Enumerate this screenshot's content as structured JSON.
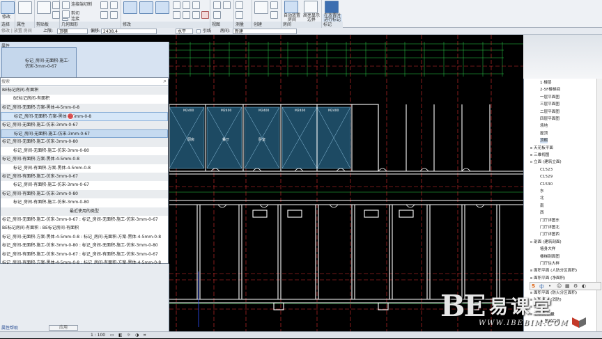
{
  "ribbon": {
    "modify_label": "修改",
    "groups": [
      {
        "label": "选择"
      },
      {
        "label": "属性"
      },
      {
        "label": "剪贴板"
      },
      {
        "label": "几何图形"
      },
      {
        "label": "修改"
      },
      {
        "label": "视图"
      },
      {
        "label": "测量"
      },
      {
        "label": "创建"
      },
      {
        "label": "房间"
      },
      {
        "label": "标记"
      }
    ],
    "geometry_texts": [
      "连接端切割",
      "剪切",
      "连接"
    ],
    "room_buttons": [
      {
        "label": "自动放置房间"
      },
      {
        "label": "高亮显示边界"
      }
    ],
    "tag_button": {
      "label": "在放置时进行标记"
    }
  },
  "optbar": {
    "context": "修改 | 放置 房间",
    "upper_label": "上限:",
    "upper_value": "顶棚",
    "offset_label": "偏移:",
    "offset_value": "2438.4",
    "orient_value": "水平",
    "leader_label": "引线",
    "room_label": "房间:",
    "room_value": "新建"
  },
  "properties": {
    "title": "属性",
    "type_name": "标记_房间-无面积-施工-\n仿宋-3mm-0-67",
    "search_placeholder": "搜索",
    "help_link": "属性帮助",
    "apply_label": "应用"
  },
  "dropdown": {
    "rows": [
      {
        "text": "BE标记房间-有面积",
        "kind": "header"
      },
      {
        "text": "BE标记房间-有面积",
        "kind": "item"
      },
      {
        "text": "标记_房间-无面积-方案-黑体-4-5mm-0-8",
        "kind": "header"
      },
      {
        "text": "标记_房间-无面积-方案-黑体-4-5mm-0-8",
        "kind": "hover"
      },
      {
        "text": "标记_房间-无面积-施工-仿宋-3mm-0-67",
        "kind": "header"
      },
      {
        "text": "标记_房间-无面积-施工-仿宋-3mm-0-67",
        "kind": "sel"
      },
      {
        "text": "标记_房间-无面积-施工-仿宋-3mm-0-80",
        "kind": "header"
      },
      {
        "text": "标记_房间-无面积-施工-仿宋-3mm-0-80",
        "kind": "item"
      },
      {
        "text": "标记_房间-有面积-方案-黑体-4-5mm-0-8",
        "kind": "header"
      },
      {
        "text": "标记_房间-有面积-方案-黑体-4-5mm-0-8",
        "kind": "item"
      },
      {
        "text": "标记_房间-有面积-施工-仿宋-3mm-0-67",
        "kind": "header"
      },
      {
        "text": "标记_房间-有面积-施工-仿宋-3mm-0-67",
        "kind": "item"
      },
      {
        "text": "标记_房间-有面积-施工-仿宋-3mm-0-80",
        "kind": "header"
      },
      {
        "text": "标记_房间-有面积-施工-仿宋-3mm-0-80",
        "kind": "item"
      },
      {
        "text": "最近使用的类型",
        "kind": "center"
      },
      {
        "text": "标记_房间-无面积-施工-仿宋-3mm-0-67 : 标记_房间-无面积-施工-仿宋-3mm-0-67",
        "kind": "plain"
      },
      {
        "text": "BE标记房间-有面积 : BE标记房间-有面积",
        "kind": "plain"
      },
      {
        "text": "标记_房间-无面积-方案-黑体-4-5mm-0-8 : 标记_房间-无面积-方案-黑体-4-5mm-0-8",
        "kind": "plain"
      },
      {
        "text": "标记_房间-无面积-施工-仿宋-3mm-0-80 : 标记_房间-无面积-施工-仿宋-3mm-0-80",
        "kind": "plain"
      },
      {
        "text": "标记_房间-有面积-施工-仿宋-3mm-0-67 : 标记_房间-有面积-施工-仿宋-3mm-0-67",
        "kind": "plain"
      },
      {
        "text": "标记_房间-有面积-方案-黑体-4-5mm-0-8 : 标记_房间-有面积-方案-黑体-4-5mm-0-8",
        "kind": "plain"
      }
    ]
  },
  "browser": {
    "items": [
      {
        "text": "1 楼层",
        "indent": 3
      },
      {
        "text": "2-5F楼梯间",
        "indent": 3
      },
      {
        "text": "一层平面图",
        "indent": 3
      },
      {
        "text": "三层平面图",
        "indent": 3
      },
      {
        "text": "二层平面图",
        "indent": 3
      },
      {
        "text": "四层平面图",
        "indent": 3
      },
      {
        "text": "场地",
        "indent": 3
      },
      {
        "text": "屋顶",
        "indent": 3
      },
      {
        "text": "顶棚",
        "indent": 3,
        "selected": true
      },
      {
        "text": "天花板平面",
        "indent": 1,
        "twist": "+"
      },
      {
        "text": "三维视图",
        "indent": 1,
        "twist": "+"
      },
      {
        "text": "立面 (建筑立面)",
        "indent": 1,
        "twist": "-"
      },
      {
        "text": "C1523",
        "indent": 3
      },
      {
        "text": "C1529",
        "indent": 3
      },
      {
        "text": "C1530",
        "indent": 3
      },
      {
        "text": "东",
        "indent": 3
      },
      {
        "text": "北",
        "indent": 3
      },
      {
        "text": "南",
        "indent": 3
      },
      {
        "text": "西",
        "indent": 3
      },
      {
        "text": "门厅详图东",
        "indent": 3
      },
      {
        "text": "门厅详图北",
        "indent": 3
      },
      {
        "text": "门厅详图西",
        "indent": 3
      },
      {
        "text": "剖面 (建筑剖面)",
        "indent": 1,
        "twist": "-"
      },
      {
        "text": "墙身大样",
        "indent": 3
      },
      {
        "text": "楼梯剖面图",
        "indent": 3
      },
      {
        "text": "门厅住大样",
        "indent": 3
      },
      {
        "text": "面积平面 (人防分区面积)",
        "indent": 1,
        "twist": "+"
      },
      {
        "text": "面积平面 (净面积)",
        "indent": 1,
        "twist": "+"
      },
      {
        "text": "面积平面 (总建筑面积)",
        "indent": 1,
        "twist": "+"
      },
      {
        "text": "面积平面 (防火分区面积)",
        "indent": 1,
        "twist": "+"
      },
      {
        "text": "面积平面 (消防)",
        "indent": 1,
        "twist": "+"
      },
      {
        "text": "图例",
        "indent": 1,
        "twist": "+"
      },
      {
        "text": "明细表/数量",
        "indent": 1,
        "twist": "+"
      },
      {
        "text": "A_图纸目录",
        "indent": 3
      }
    ]
  },
  "canvas": {
    "room_tags": [
      "厨房",
      "餐厅",
      "卧室"
    ],
    "door_tag": "M2400"
  },
  "statusbar": {
    "scale": "1 : 100"
  },
  "sogou": {
    "label": "中"
  },
  "watermark": {
    "logo": "BE",
    "name": "易课堂",
    "url": "WWW.IBEBIM.COM"
  }
}
